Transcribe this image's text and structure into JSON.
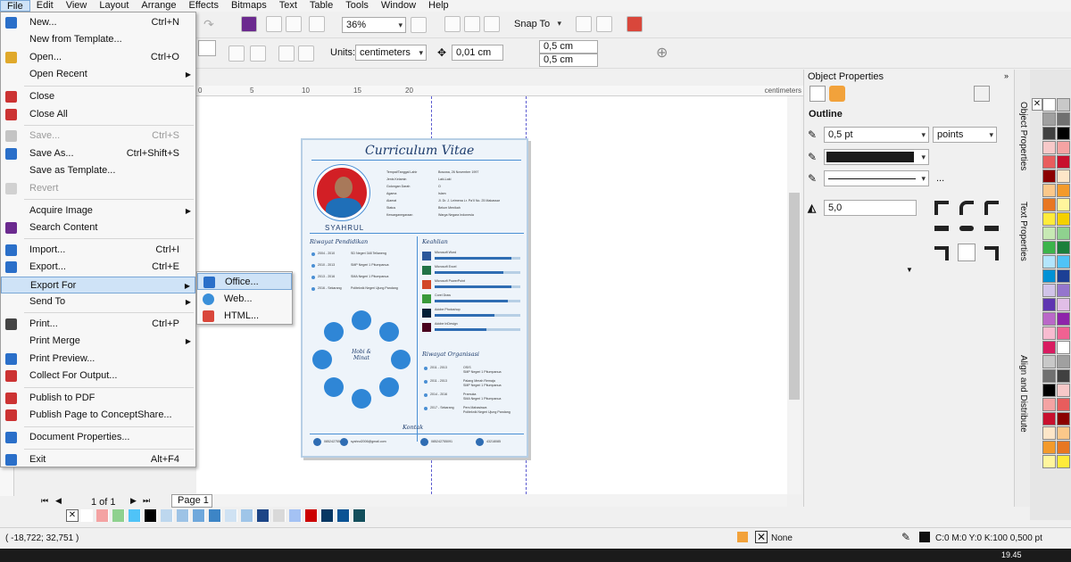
{
  "menubar": {
    "items": [
      "File",
      "Edit",
      "View",
      "Layout",
      "Arrange",
      "Effects",
      "Bitmaps",
      "Text",
      "Table",
      "Tools",
      "Window",
      "Help"
    ]
  },
  "toolbar": {
    "zoom": "36%",
    "snap": "Snap To",
    "units_label": "Units:",
    "units_value": "centimeters",
    "nudge": "0,01 cm",
    "dup_x": "0,5 cm",
    "dup_y": "0,5 cm"
  },
  "ruler": {
    "ticks": [
      "0",
      "5",
      "10",
      "15",
      "20"
    ],
    "unit": "centimeters"
  },
  "file_menu": {
    "items": [
      {
        "label": "New...",
        "shortcut": "Ctrl+N",
        "icon": "new-doc-icon"
      },
      {
        "label": "New from Template...",
        "shortcut": "",
        "icon": ""
      },
      {
        "label": "Open...",
        "shortcut": "Ctrl+O",
        "icon": "open-folder-icon"
      },
      {
        "label": "Open Recent",
        "shortcut": "",
        "icon": "",
        "submenu": true
      },
      {
        "label": "Close",
        "shortcut": "",
        "icon": "close-doc-icon"
      },
      {
        "label": "Close All",
        "shortcut": "",
        "icon": "close-all-icon"
      },
      {
        "label": "Save...",
        "shortcut": "Ctrl+S",
        "icon": "save-icon",
        "disabled": true
      },
      {
        "label": "Save As...",
        "shortcut": "Ctrl+Shift+S",
        "icon": "save-as-icon"
      },
      {
        "label": "Save as Template...",
        "shortcut": "",
        "icon": ""
      },
      {
        "label": "Revert",
        "shortcut": "",
        "icon": "revert-icon",
        "disabled": true
      },
      {
        "label": "Acquire Image",
        "shortcut": "",
        "icon": "",
        "submenu": true
      },
      {
        "label": "Search Content",
        "shortcut": "",
        "icon": "search-content-icon"
      },
      {
        "label": "Import...",
        "shortcut": "Ctrl+I",
        "icon": "import-icon"
      },
      {
        "label": "Export...",
        "shortcut": "Ctrl+E",
        "icon": "export-icon"
      },
      {
        "label": "Export For",
        "shortcut": "",
        "icon": "",
        "submenu": true,
        "highlight": true
      },
      {
        "label": "Send To",
        "shortcut": "",
        "icon": "",
        "submenu": true
      },
      {
        "label": "Print...",
        "shortcut": "Ctrl+P",
        "icon": "print-icon"
      },
      {
        "label": "Print Merge",
        "shortcut": "",
        "icon": "",
        "submenu": true
      },
      {
        "label": "Print Preview...",
        "shortcut": "",
        "icon": "print-preview-icon"
      },
      {
        "label": "Collect For Output...",
        "shortcut": "",
        "icon": "collect-icon"
      },
      {
        "label": "Publish to PDF",
        "shortcut": "",
        "icon": "pdf-icon"
      },
      {
        "label": "Publish Page to ConceptShare...",
        "shortcut": "",
        "icon": "conceptshare-icon"
      },
      {
        "label": "Document Properties...",
        "shortcut": "",
        "icon": "doc-props-icon"
      },
      {
        "label": "Exit",
        "shortcut": "Alt+F4",
        "icon": "exit-icon"
      }
    ]
  },
  "export_for_submenu": [
    "Office...",
    "Web...",
    "HTML..."
  ],
  "panel": {
    "title": "Object Properties",
    "section": "Outline",
    "width": "0,5 pt",
    "width_unit": "points",
    "miter": "5,0",
    "ellipsis": "...",
    "tabs": [
      "Object Properties",
      "Text Properties",
      "Align and Distribute"
    ]
  },
  "page_nav": {
    "counter": "1 of 1",
    "tab": "Page 1"
  },
  "status": {
    "coords": "( -18,722; 32,751 )",
    "fill": "None",
    "outline": "C:0 M:0 Y:0 K:100  0,500 pt",
    "time": "19.45"
  },
  "cv": {
    "title": "Curriculum Vitae",
    "name": "SYAHRUL",
    "bio_labels": [
      "Tempat/Tanggal Lahir",
      "Jenis Kelamin",
      "Golongan Darah",
      "Agama",
      "Alamat",
      "Status",
      "Kewarganegaraan"
    ],
    "bio_values": [
      "Bosowa, 26 November 1997",
      "Laki-Laki",
      "O",
      "Islam",
      "Jl. Dr. J. Leimena Lr. Pa'II No. 25 Makassar",
      "Belum Menikah",
      "Warga Negara Indonesia"
    ],
    "edu_title": "Riwayat Pendidikan",
    "edu": [
      [
        "2004 - 2010",
        "SD Negeri 348 Tellaneng"
      ],
      [
        "2010 - 2013",
        "SMP Negeri 1 Pitumpanua"
      ],
      [
        "2013 - 2016",
        "SMA Negeri 1 Pitumpanua"
      ],
      [
        "2016 - Sekarang",
        "Politeknik Negeri Ujung Pandang"
      ]
    ],
    "skill_title": "Keahlian",
    "skills": [
      {
        "name": "Microsoft Word",
        "level": 0.9
      },
      {
        "name": "Microsoft Excel",
        "level": 0.8
      },
      {
        "name": "Microsoft PowerPoint",
        "level": 0.9
      },
      {
        "name": "Corel Draw",
        "level": 0.85
      },
      {
        "name": "Adobe Photoshop",
        "level": 0.7
      },
      {
        "name": "Adobe InDesign",
        "level": 0.6
      }
    ],
    "hobby_title": "Hobi & Minat",
    "org_title": "Riwayat Organisasi",
    "org": [
      [
        "2011 - 2013",
        "OSIS",
        "SMP Negeri 1 Pitumpanua"
      ],
      [
        "2011 - 2013",
        "Palang Merah Remaja",
        "SMP Negeri 1 Pitumpanua"
      ],
      [
        "2014 - 2016",
        "Pramuka",
        "SMA Negeri 1 Pitumpanua"
      ],
      [
        "2017 - Sekarang",
        "Pers Mahasiswa",
        "Politeknik Negeri Ujung Pandang"
      ]
    ],
    "contact_title": "Kontak",
    "contacts": [
      "085242755091",
      "syahrul2006@gmail.com",
      "085242755091",
      "43218085"
    ]
  },
  "colors": {
    "accent": "#4a8fd4",
    "cv_dark": "#1b3a6b",
    "menu_highlight": "#cfe3f7"
  }
}
